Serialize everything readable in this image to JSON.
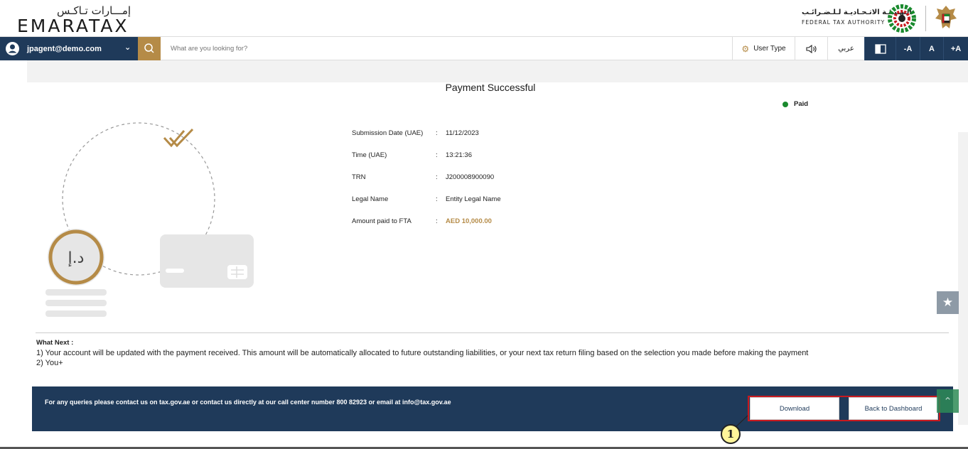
{
  "header": {
    "logo_ar": "إمـــارات تـاكـس",
    "logo_en": "EMARATAX",
    "fta_ar": "الـهـيـئـة الاتـحـاديـة لـلـضـرائـب",
    "fta_en": "FEDERAL TAX AUTHORITY"
  },
  "toolbar": {
    "user_email": "jpagent@demo.com",
    "search_placeholder": "What are you looking for?",
    "user_type": "User Type",
    "language": "عربي",
    "font_decrease": "-A",
    "font_normal": "A",
    "font_increase": "+A"
  },
  "main": {
    "title": "Payment Successful",
    "status": "Paid",
    "status_color": "#1a8a2e",
    "coin_symbol": "د.إ",
    "details": [
      {
        "label": "Submission Date (UAE)",
        "value": "11/12/2023"
      },
      {
        "label": "Time (UAE)",
        "value": "13:21:36"
      },
      {
        "label": "TRN",
        "value": "J200008900090"
      },
      {
        "label": "Legal Name",
        "value": "Entity Legal Name"
      },
      {
        "label": "Amount paid to FTA",
        "value": "AED 10,000.00"
      }
    ],
    "separator": ":",
    "what_next_title": "What Next :",
    "what_next_1": "1) Your account will be updated with the payment received. This amount will be automatically allocated to future outstanding liabilities, or your next tax return filing based on the selection you made before making the payment",
    "what_next_2": "2) You+"
  },
  "footer": {
    "message": "For any queries please contact us on tax.gov.ae or contact us directly at our call center number 800 82923 or email at info@tax.gov.ae",
    "download_label": "Download",
    "back_label": "Back to Dashboard"
  },
  "annotation": {
    "callout_number": "1"
  },
  "colors": {
    "navy": "#1f3a5a",
    "gold": "#b58b47",
    "highlight": "#c8191f"
  }
}
